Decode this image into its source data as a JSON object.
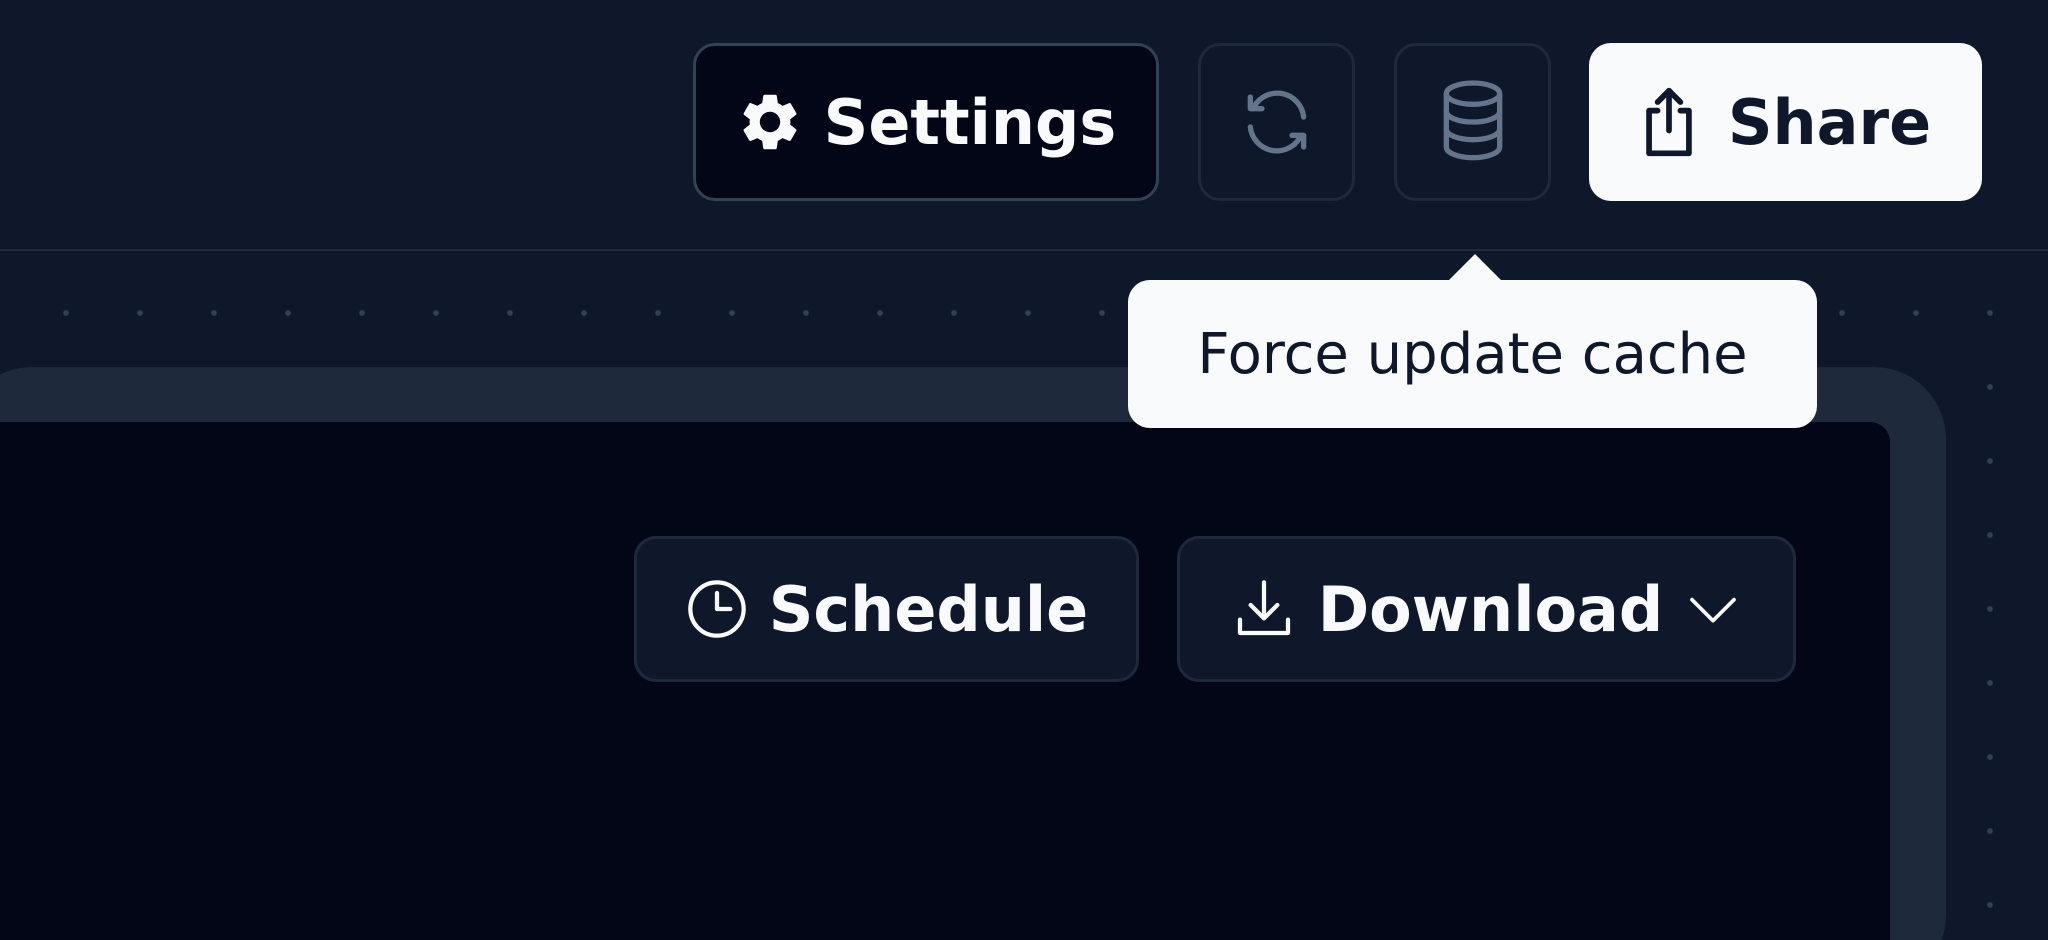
{
  "toolbar": {
    "settings": {
      "label": "Settings",
      "icon": "gear-icon"
    },
    "refresh": {
      "icon": "refresh-icon"
    },
    "cache": {
      "icon": "database-icon"
    },
    "share": {
      "label": "Share",
      "icon": "share-icon"
    }
  },
  "tooltip": {
    "text": "Force update cache"
  },
  "panel": {
    "schedule": {
      "label": "Schedule",
      "icon": "clock-icon"
    },
    "download": {
      "label": "Download",
      "icon": "download-icon",
      "menu_icon": "chevron-down-icon"
    }
  },
  "colors": {
    "background": "#0f172a",
    "surface_dark": "#020617",
    "border": "#334155",
    "border_subtle": "#1e293b",
    "foreground": "#f8fafc",
    "muted_icon": "#64748b"
  }
}
